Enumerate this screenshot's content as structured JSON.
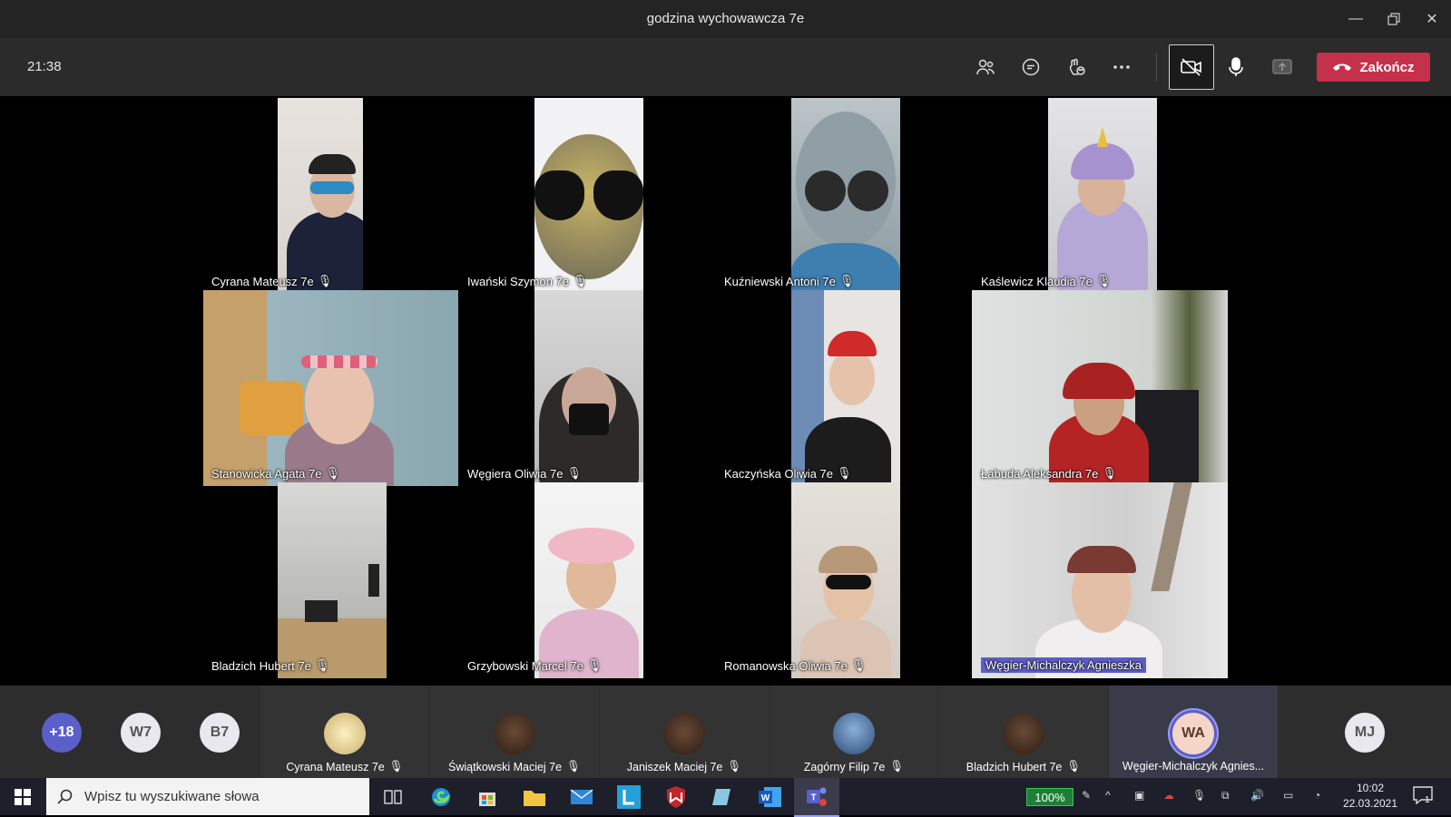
{
  "window": {
    "title": "godzina wychowawcza 7e"
  },
  "toolbar": {
    "timer": "21:38",
    "end_label": "Zakończ"
  },
  "tiles": [
    {
      "name": "Cyrana Mateusz 7e"
    },
    {
      "name": "Iwański Szymon 7e"
    },
    {
      "name": "Kuźniewski Antoni 7e"
    },
    {
      "name": "Kaślewicz Klaudia 7e"
    },
    {
      "name": "Stanowicka Agata 7e"
    },
    {
      "name": "Węgiera Oliwia 7e"
    },
    {
      "name": "Kaczyńska Oliwia 7e"
    },
    {
      "name": "Łabuda Aleksandra 7e"
    },
    {
      "name": "Bladzich Hubert 7e"
    },
    {
      "name": "Grzybowski Marcel 7e"
    },
    {
      "name": "Romanowska Oliwia 7e"
    },
    {
      "name": "Węgier-Michalczyk Agnieszka"
    }
  ],
  "strip": {
    "more_count": "+18",
    "avatars": [
      "W7",
      "B7"
    ],
    "people": [
      {
        "name": "Cyrana Mateusz 7e"
      },
      {
        "name": "Świątkowski Maciej 7e"
      },
      {
        "name": "Janiszek Maciej 7e"
      },
      {
        "name": "Zagórny Filip 7e"
      },
      {
        "name": "Bladzich Hubert 7e"
      },
      {
        "name": "Węgier-Michalczyk Agnies...",
        "initials": "WA"
      }
    ],
    "last_avatar": "MJ"
  },
  "taskbar": {
    "search_placeholder": "Wpisz tu wyszukiwane słowa",
    "battery": "100%",
    "time": "10:02",
    "date": "22.03.2021",
    "notifications": "1"
  },
  "colors": {
    "accent": "#5b5fc7",
    "end_call": "#c4314b",
    "toolbar": "#2b2b2b"
  }
}
